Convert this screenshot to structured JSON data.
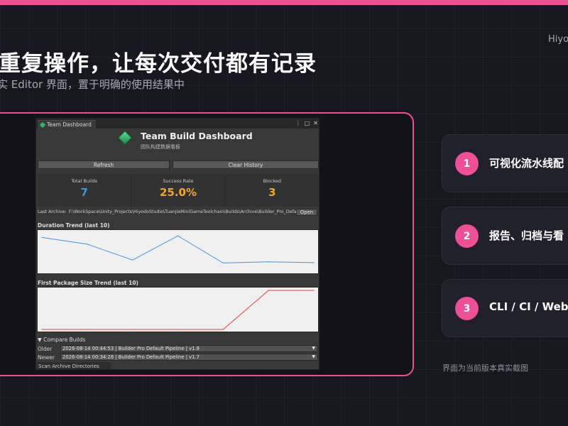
{
  "brand": "Hiyo",
  "headline": "重复操作，让每次交付都有记录",
  "subline": "实 Editor 界面，置于明确的使用结果中",
  "editor": {
    "tab_label": "Team Dashboard",
    "title": "Team Build Dashboard",
    "subtitle": "团队构建数据看板",
    "refresh_label": "Refresh",
    "clear_history_label": "Clear History",
    "stats": [
      {
        "label": "Total Builds",
        "value": "7",
        "color": "#4a90e2"
      },
      {
        "label": "Success Rate",
        "value": "25.0%",
        "color": "#f5a623"
      },
      {
        "label": "Blocked",
        "value": "3",
        "color": "#f5a623"
      }
    ],
    "archive_label": "Last Archive:",
    "archive_path": "F:\\WorkSpace\\Unity_Projects\\HiyodoStudio\\TuanjieMiniGameToolchain\\Builds\\Archive\\Builder_Pro_Defau",
    "open_label": "Open",
    "compare_title": "Compare Builds",
    "older_label": "Older",
    "older_value": "2026-08-14 00:44:53 | Builder Pro Default Pipeline | v1.8",
    "newer_label": "Newer",
    "newer_value": "2026-08-14 00:34:28 | Builder Pro Default Pipeline | v1.7",
    "scan_label": "Scan Archive Directories"
  },
  "chart_data": [
    {
      "type": "line",
      "title": "Duration Trend (last 10)",
      "x": [
        1,
        2,
        3,
        4,
        5,
        6,
        7
      ],
      "series": [
        {
          "values": [
            0.88,
            0.7,
            0.28,
            0.92,
            0.2,
            0.23,
            0.21
          ],
          "color": "#4a90e2"
        }
      ],
      "ylim": [
        0,
        1
      ],
      "grid": false
    },
    {
      "type": "line",
      "title": "First Package Size Trend (last 10)",
      "x": [
        1,
        2,
        3,
        4,
        5,
        6,
        7
      ],
      "series": [
        {
          "values": [
            0,
            0,
            0,
            0,
            0,
            1,
            1
          ],
          "color": "#e0443a"
        }
      ],
      "ylim": [
        0,
        1
      ],
      "grid": false
    }
  ],
  "cards": [
    {
      "num": "1",
      "text": "可视化流水线配"
    },
    {
      "num": "2",
      "text": "报告、归档与看"
    },
    {
      "num": "3",
      "text": "CLI / CI / Web"
    }
  ],
  "caption": "界面为当前版本真实截图"
}
